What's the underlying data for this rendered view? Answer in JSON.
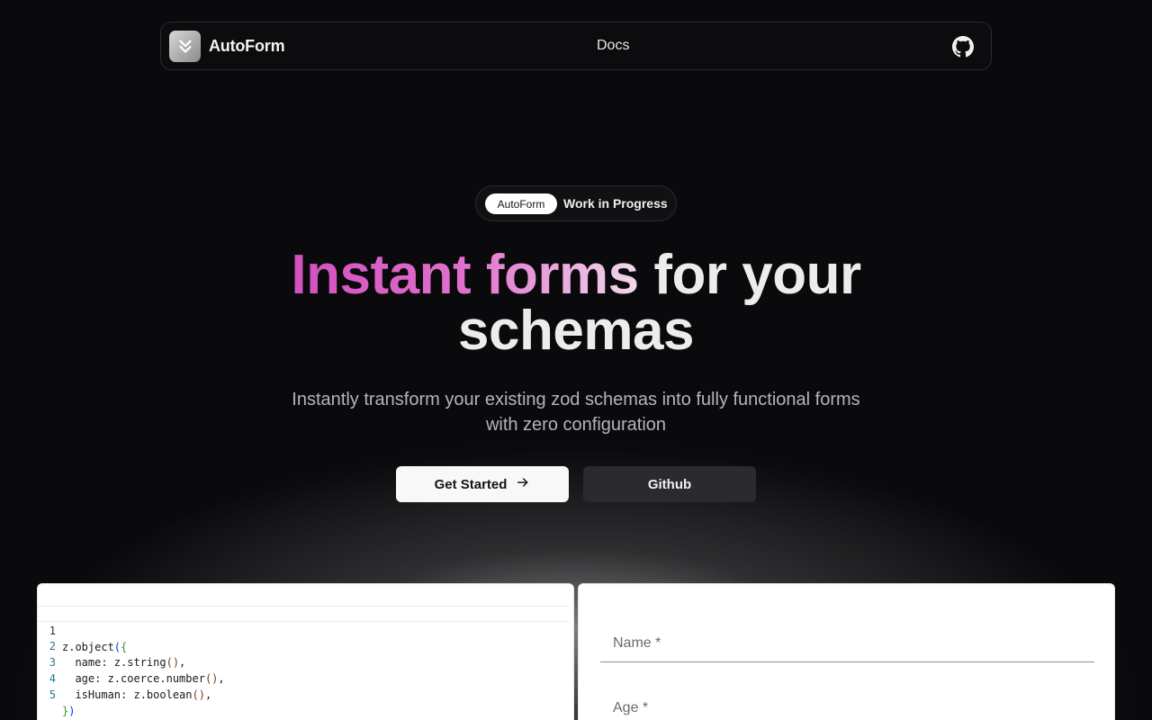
{
  "nav": {
    "brand": "AutoForm",
    "links": [
      "Docs"
    ],
    "github_icon": "github-icon"
  },
  "badge": {
    "pill": "AutoForm",
    "text": "Work in Progress"
  },
  "hero": {
    "headline_highlight": "Instant forms",
    "headline_rest_1": "for your",
    "headline_rest_2": "schemas",
    "subtitle": "Instantly transform your existing zod schemas into fully functional forms with zero configuration"
  },
  "buttons": {
    "primary": "Get Started",
    "secondary": "Github"
  },
  "editor": {
    "lines": [
      {
        "n": "1",
        "text": "z.object({"
      },
      {
        "n": "2",
        "text": "  name: z.string(),"
      },
      {
        "n": "3",
        "text": "  age: z.coerce.number(),"
      },
      {
        "n": "4",
        "text": "  isHuman: z.boolean(),"
      },
      {
        "n": "5",
        "text": "})"
      }
    ]
  },
  "form": {
    "fields": [
      {
        "label": "Name *"
      },
      {
        "label": "Age *"
      }
    ]
  },
  "colors": {
    "background": "#0a0a0c",
    "accent_gradient_start": "#d24fc0",
    "accent_gradient_end": "#f0d9ee"
  }
}
